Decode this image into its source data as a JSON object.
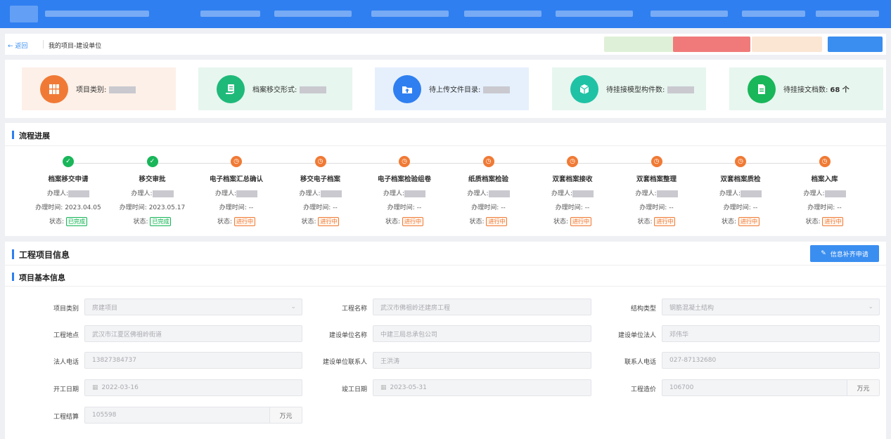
{
  "header": {
    "back_label": "← 返回",
    "breadcrumb": "我的项目-建设单位"
  },
  "stats": [
    {
      "label": "项目类别:",
      "value": "",
      "icon": "archive-icon",
      "bg": "#fdf0e8",
      "icon_bg": "#f07a35"
    },
    {
      "label": "档案移交形式:",
      "value": "",
      "icon": "document-hand-icon",
      "bg": "#e7f6ef",
      "icon_bg": "#1fb97a"
    },
    {
      "label": "待上传文件目录:",
      "value": "",
      "icon": "upload-folder-icon",
      "bg": "#e6f0fd",
      "icon_bg": "#2f7ff0"
    },
    {
      "label": "待挂接模型构件数:",
      "value": "",
      "icon": "cube-icon",
      "bg": "#e7f6ef",
      "icon_bg": "#1fc2a4"
    },
    {
      "label": "待挂接文档数:",
      "value": "68 个",
      "icon": "file-icon",
      "bg": "#e7f6ef",
      "icon_bg": "#19b65a"
    }
  ],
  "flow": {
    "title": "流程进展",
    "handler_label": "办理人:",
    "time_label": "办理时间:",
    "status_label": "状态:",
    "steps": [
      {
        "name": "档案移交申请",
        "time": "2023.04.05",
        "status": "已完成",
        "state": "done"
      },
      {
        "name": "移交审批",
        "time": "2023.05.17",
        "status": "已完成",
        "state": "done"
      },
      {
        "name": "电子档案汇总确认",
        "time": "--",
        "status": "进行中",
        "state": "prog"
      },
      {
        "name": "移交电子档案",
        "time": "--",
        "status": "进行中",
        "state": "prog"
      },
      {
        "name": "电子档案检验组卷",
        "time": "--",
        "status": "进行中",
        "state": "prog"
      },
      {
        "name": "纸质档案检验",
        "time": "--",
        "status": "进行中",
        "state": "prog"
      },
      {
        "name": "双套档案接收",
        "time": "--",
        "status": "进行中",
        "state": "prog"
      },
      {
        "name": "双套档案整理",
        "time": "--",
        "status": "进行中",
        "state": "prog"
      },
      {
        "name": "双套档案质检",
        "time": "--",
        "status": "进行中",
        "state": "prog"
      },
      {
        "name": "档案入库",
        "time": "--",
        "status": "进行中",
        "state": "prog"
      }
    ]
  },
  "project": {
    "title": "工程项目信息",
    "supplement_button": "信息补齐申请",
    "basic_title": "项目基本信息",
    "fields": {
      "category": {
        "label": "项目类别",
        "value": "房建项目"
      },
      "name": {
        "label": "工程名称",
        "value": "武汉市佛祖岭还建房工程"
      },
      "structure": {
        "label": "结构类型",
        "value": "钢筋混凝土结构"
      },
      "location": {
        "label": "工程地点",
        "value": "武汉市江夏区佛祖岭街道"
      },
      "builder": {
        "label": "建设单位名称",
        "value": "中建三局总承包公司"
      },
      "legal_person": {
        "label": "建设单位法人",
        "value": "邓伟华"
      },
      "legal_phone": {
        "label": "法人电话",
        "value": "13827384737"
      },
      "contact": {
        "label": "建设单位联系人",
        "value": "王洪涛"
      },
      "contact_phone": {
        "label": "联系人电话",
        "value": "027-87132680"
      },
      "start_date": {
        "label": "开工日期",
        "value": "2022-03-16"
      },
      "end_date": {
        "label": "竣工日期",
        "value": "2023-05-31"
      },
      "cost": {
        "label": "工程造价",
        "value": "106700",
        "unit": "万元"
      },
      "settlement": {
        "label": "工程结算",
        "value": "105598",
        "unit": "万元"
      }
    }
  }
}
